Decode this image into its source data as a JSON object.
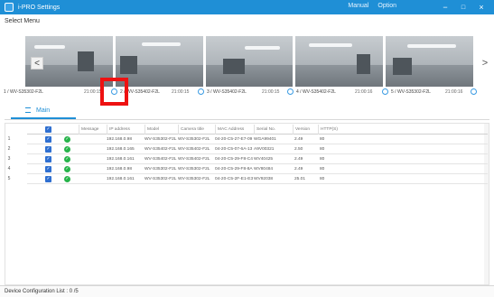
{
  "window": {
    "title": "i-PRO Settings",
    "links": [
      "Manual",
      "Option"
    ],
    "controls": {
      "minimize": "−",
      "maximize": "□",
      "close": "×"
    }
  },
  "select_menu_label": "Select Menu",
  "carousel": {
    "prev": "<",
    "next": ">",
    "cameras": [
      {
        "label": "1 / WV-S35302-F2L",
        "time": "21:00:15"
      },
      {
        "label": "2 / WV-S35402-F2L",
        "time": "21:00:15"
      },
      {
        "label": "3 / WV-S35402-F2L",
        "time": "21:00:15"
      },
      {
        "label": "4 / WV-S35402-F2L",
        "time": "21:00:16"
      },
      {
        "label": "5 / WV-S35302-F2L",
        "time": "21:00:16"
      }
    ]
  },
  "tabs": [
    {
      "label": "Main"
    }
  ],
  "device_table": {
    "columns": [
      "Message",
      "IP address",
      "Model",
      "Camera title",
      "MAC Address",
      "Serial No.",
      "Version",
      "HTTP(S)"
    ],
    "rows": [
      {
        "no": "1",
        "ip": "192.168.0.98",
        "model": "WV-S35302-F2L",
        "title": "WV-S35302-F2L",
        "mac": "04-20-C5-27-E7-09",
        "serial": "WGA99401",
        "version": "2.49",
        "http": "80"
      },
      {
        "no": "2",
        "ip": "192.168.0.165",
        "model": "WV-S35402-F2L",
        "title": "WV-S35402-F2L",
        "mac": "04-20-C5-07-6A-13",
        "serial": "A9V00321",
        "version": "2.50",
        "http": "80"
      },
      {
        "no": "3",
        "ip": "192.168.0.161",
        "model": "WV-S35402-F2L",
        "title": "WV-S35402-F2L",
        "mac": "04-20-C5-29-F8-C4",
        "serial": "WV40425",
        "version": "2.49",
        "http": "80"
      },
      {
        "no": "4",
        "ip": "192.168.0.98",
        "model": "WV-S35302-F2L",
        "title": "WV-S35302-F2L",
        "mac": "04-20-C5-29-F8-8A",
        "serial": "WV80484",
        "version": "2.49",
        "http": "80"
      },
      {
        "no": "5",
        "ip": "192.168.0.161",
        "model": "WV-S35302-F2L",
        "title": "WV-S35302-F2L",
        "mac": "04-20-C5-2F-E1-E3",
        "serial": "WV92038",
        "version": "25.01",
        "http": "80"
      }
    ]
  },
  "footer": {
    "text": "Device Configuration List : 0 /5"
  },
  "colors": {
    "titlebar": "#1f8fd6",
    "highlight": "#ee1111",
    "check": "#2f6fd0",
    "ok": "#26b34a"
  }
}
